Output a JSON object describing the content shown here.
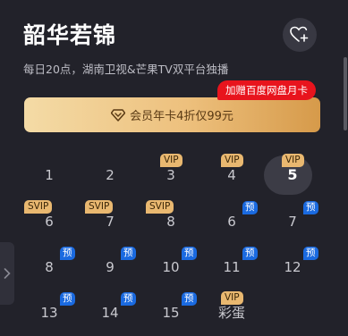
{
  "header": {
    "title": "韶华若锦",
    "subtitle": "每日20点，湖南卫视&芒果TV双平台独播"
  },
  "promo": {
    "button_label": "会员年卡4折仅99元",
    "badge": "加赠百度网盘月卡",
    "icon": "vip-diamond-icon"
  },
  "episodes": [
    {
      "num": "1",
      "badge": ""
    },
    {
      "num": "2",
      "badge": ""
    },
    {
      "num": "3",
      "badge": "VIP"
    },
    {
      "num": "4",
      "badge": "VIP"
    },
    {
      "num": "5",
      "badge": "VIP",
      "current": true
    },
    {
      "num": "6",
      "badge": "SVIP"
    },
    {
      "num": "7",
      "badge": "SVIP"
    },
    {
      "num": "8",
      "badge": "SVIP"
    },
    {
      "num": "6",
      "badge": "预"
    },
    {
      "num": "7",
      "badge": "预"
    },
    {
      "num": "8",
      "badge": "预"
    },
    {
      "num": "9",
      "badge": "预"
    },
    {
      "num": "10",
      "badge": "预"
    },
    {
      "num": "11",
      "badge": "预"
    },
    {
      "num": "12",
      "badge": "预"
    },
    {
      "num": "13",
      "badge": "预"
    },
    {
      "num": "14",
      "badge": "预"
    },
    {
      "num": "15",
      "badge": "预"
    },
    {
      "num": "彩蛋",
      "badge": "VIP"
    }
  ],
  "colors": {
    "background": "#22222a",
    "vip_badge": "#e9b870",
    "preview_badge": "#1a6ae0",
    "promo_badge": "#e8141d"
  }
}
